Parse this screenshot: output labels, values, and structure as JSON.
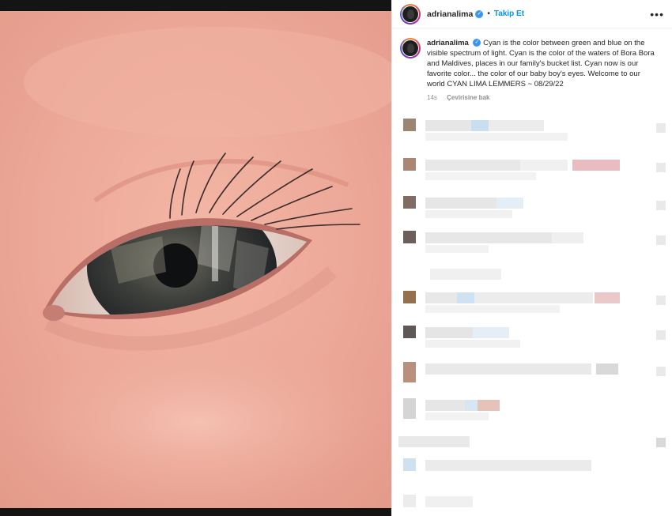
{
  "post": {
    "username": "adrianalima",
    "follow_label": "Takip Et",
    "more_label": "•••",
    "caption": "Cyan is the color between green and blue on the visible spectrum of light. Cyan is the color of the waters of Bora Bora and Maldives, places in our family's bucket list. Cyan now is our favorite color... the color of our baby boy's eyes. Welcome to our world CYAN LIMA LEMMERS ~ 08/29/22",
    "time_ago": "14s",
    "translate_label": "Çevirisine bak"
  },
  "colors": {
    "link_blue": "#0095f6",
    "verified_blue": "#3897f0",
    "meta_gray": "#8e8e8e"
  },
  "icons": {
    "verified": "verified-badge-icon",
    "more": "more-options-icon"
  }
}
